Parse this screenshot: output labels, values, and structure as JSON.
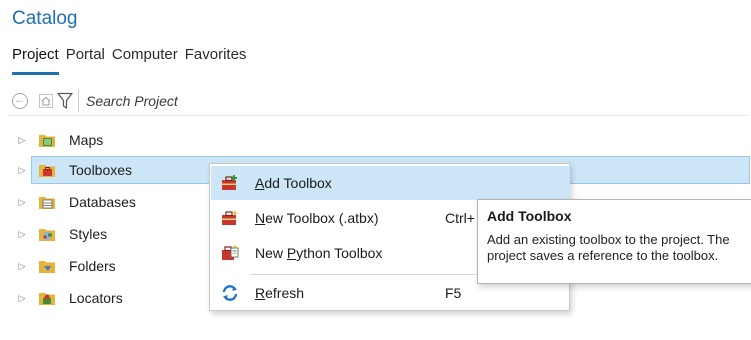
{
  "pane": {
    "title": "Catalog"
  },
  "tabs": [
    {
      "label": "Project",
      "active": true
    },
    {
      "label": "Portal",
      "active": false
    },
    {
      "label": "Computer",
      "active": false
    },
    {
      "label": "Favorites",
      "active": false
    }
  ],
  "toolbar": {
    "search_placeholder": "Search Project",
    "back_icon": "back-arrow-icon",
    "home_icon": "home-icon",
    "filter_icon": "filter-icon"
  },
  "tree": {
    "items": [
      {
        "label": "Maps",
        "icon": "maps-folder-icon",
        "selected": false
      },
      {
        "label": "Toolboxes",
        "icon": "toolboxes-folder-icon",
        "selected": true
      },
      {
        "label": "Databases",
        "icon": "databases-folder-icon",
        "selected": false
      },
      {
        "label": "Styles",
        "icon": "styles-folder-icon",
        "selected": false
      },
      {
        "label": "Folders",
        "icon": "folders-icon",
        "selected": false
      },
      {
        "label": "Locators",
        "icon": "locators-folder-icon",
        "selected": false
      }
    ]
  },
  "context_menu": {
    "items": [
      {
        "label": "Add Toolbox",
        "mnemonic": "A",
        "rest": "dd Toolbox",
        "shortcut": "",
        "icon": "add-toolbox-icon",
        "highlighted": true
      },
      {
        "label": "New Toolbox (.atbx)",
        "mnemonic": "N",
        "rest": "ew Toolbox (.atbx)",
        "shortcut": "Ctrl+",
        "icon": "new-toolbox-icon",
        "highlighted": false
      },
      {
        "label": "New Python Toolbox",
        "pre": "New ",
        "mnemonic": "P",
        "rest": "ython Toolbox",
        "shortcut": "",
        "icon": "new-python-toolbox-icon",
        "highlighted": false
      },
      {
        "label": "Refresh",
        "mnemonic": "R",
        "rest": "efresh",
        "shortcut": "F5",
        "icon": "refresh-icon",
        "highlighted": false
      }
    ]
  },
  "tooltip": {
    "title": "Add Toolbox",
    "body": "Add an existing toolbox to the project. The project saves a reference to the toolbox."
  },
  "colors": {
    "accent": "#1f6fb4",
    "selection": "#cde6f7",
    "folder_yellow": "#e8b33a",
    "toolbox_red": "#c8372d",
    "refresh_blue": "#1a73c9"
  }
}
